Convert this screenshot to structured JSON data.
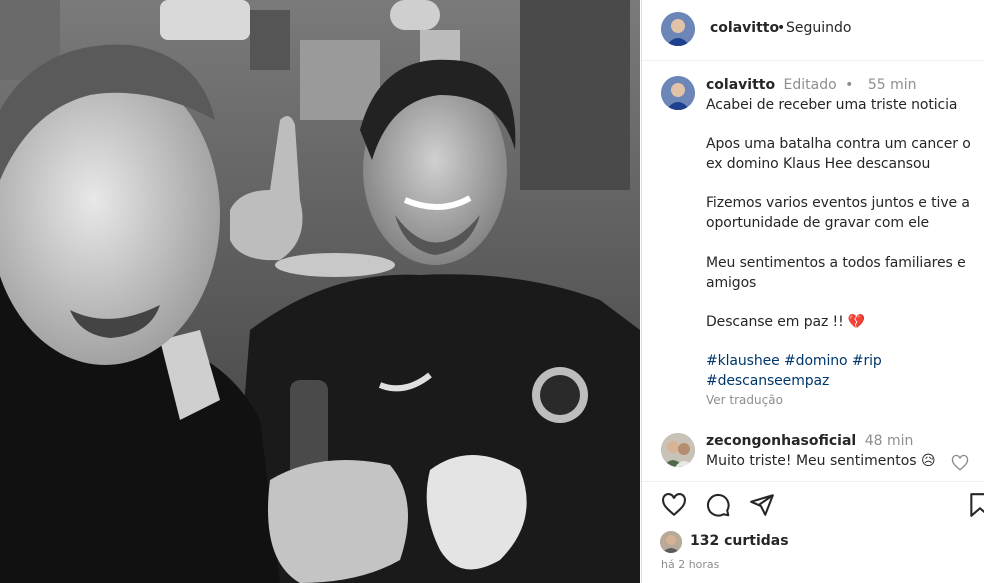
{
  "post": {
    "username": "colavitto",
    "separator": "•",
    "follow_status": "Seguindo",
    "photo_alt": "Selfie of two men in a bar, black and white"
  },
  "caption": {
    "username": "colavitto",
    "edited": "Editado",
    "separator": "•",
    "time": "55 min",
    "lines": [
      "Acabei de receber uma triste noticia",
      "Apos uma batalha contra um cancer o",
      "ex domino Klaus Hee descansou",
      "Fizemos varios eventos juntos e tive a",
      "oportunidade de gravar com ele",
      "Meu sentimentos a todos familiares e",
      "amigos",
      "Descanse em paz !! 💔"
    ],
    "hashtags_line1": "#klaushee #domino #rip",
    "hashtags_line2": "#descanseempaz",
    "translate": "Ver tradução"
  },
  "comment": {
    "username": "zecongonhasoficial",
    "time": "48 min",
    "text": "Muito triste! Meu sentimentos 😥"
  },
  "actions": {
    "like_icon": "heart-icon",
    "comment_icon": "comment-icon",
    "share_icon": "send-icon",
    "save_icon": "bookmark-icon"
  },
  "likes": {
    "text": "132 curtidas"
  },
  "timestamp": "há 2 horas",
  "colors": {
    "text": "#262626",
    "muted": "#8e8e8e",
    "hashtag": "#00376b",
    "border": "#dbdbdb"
  }
}
